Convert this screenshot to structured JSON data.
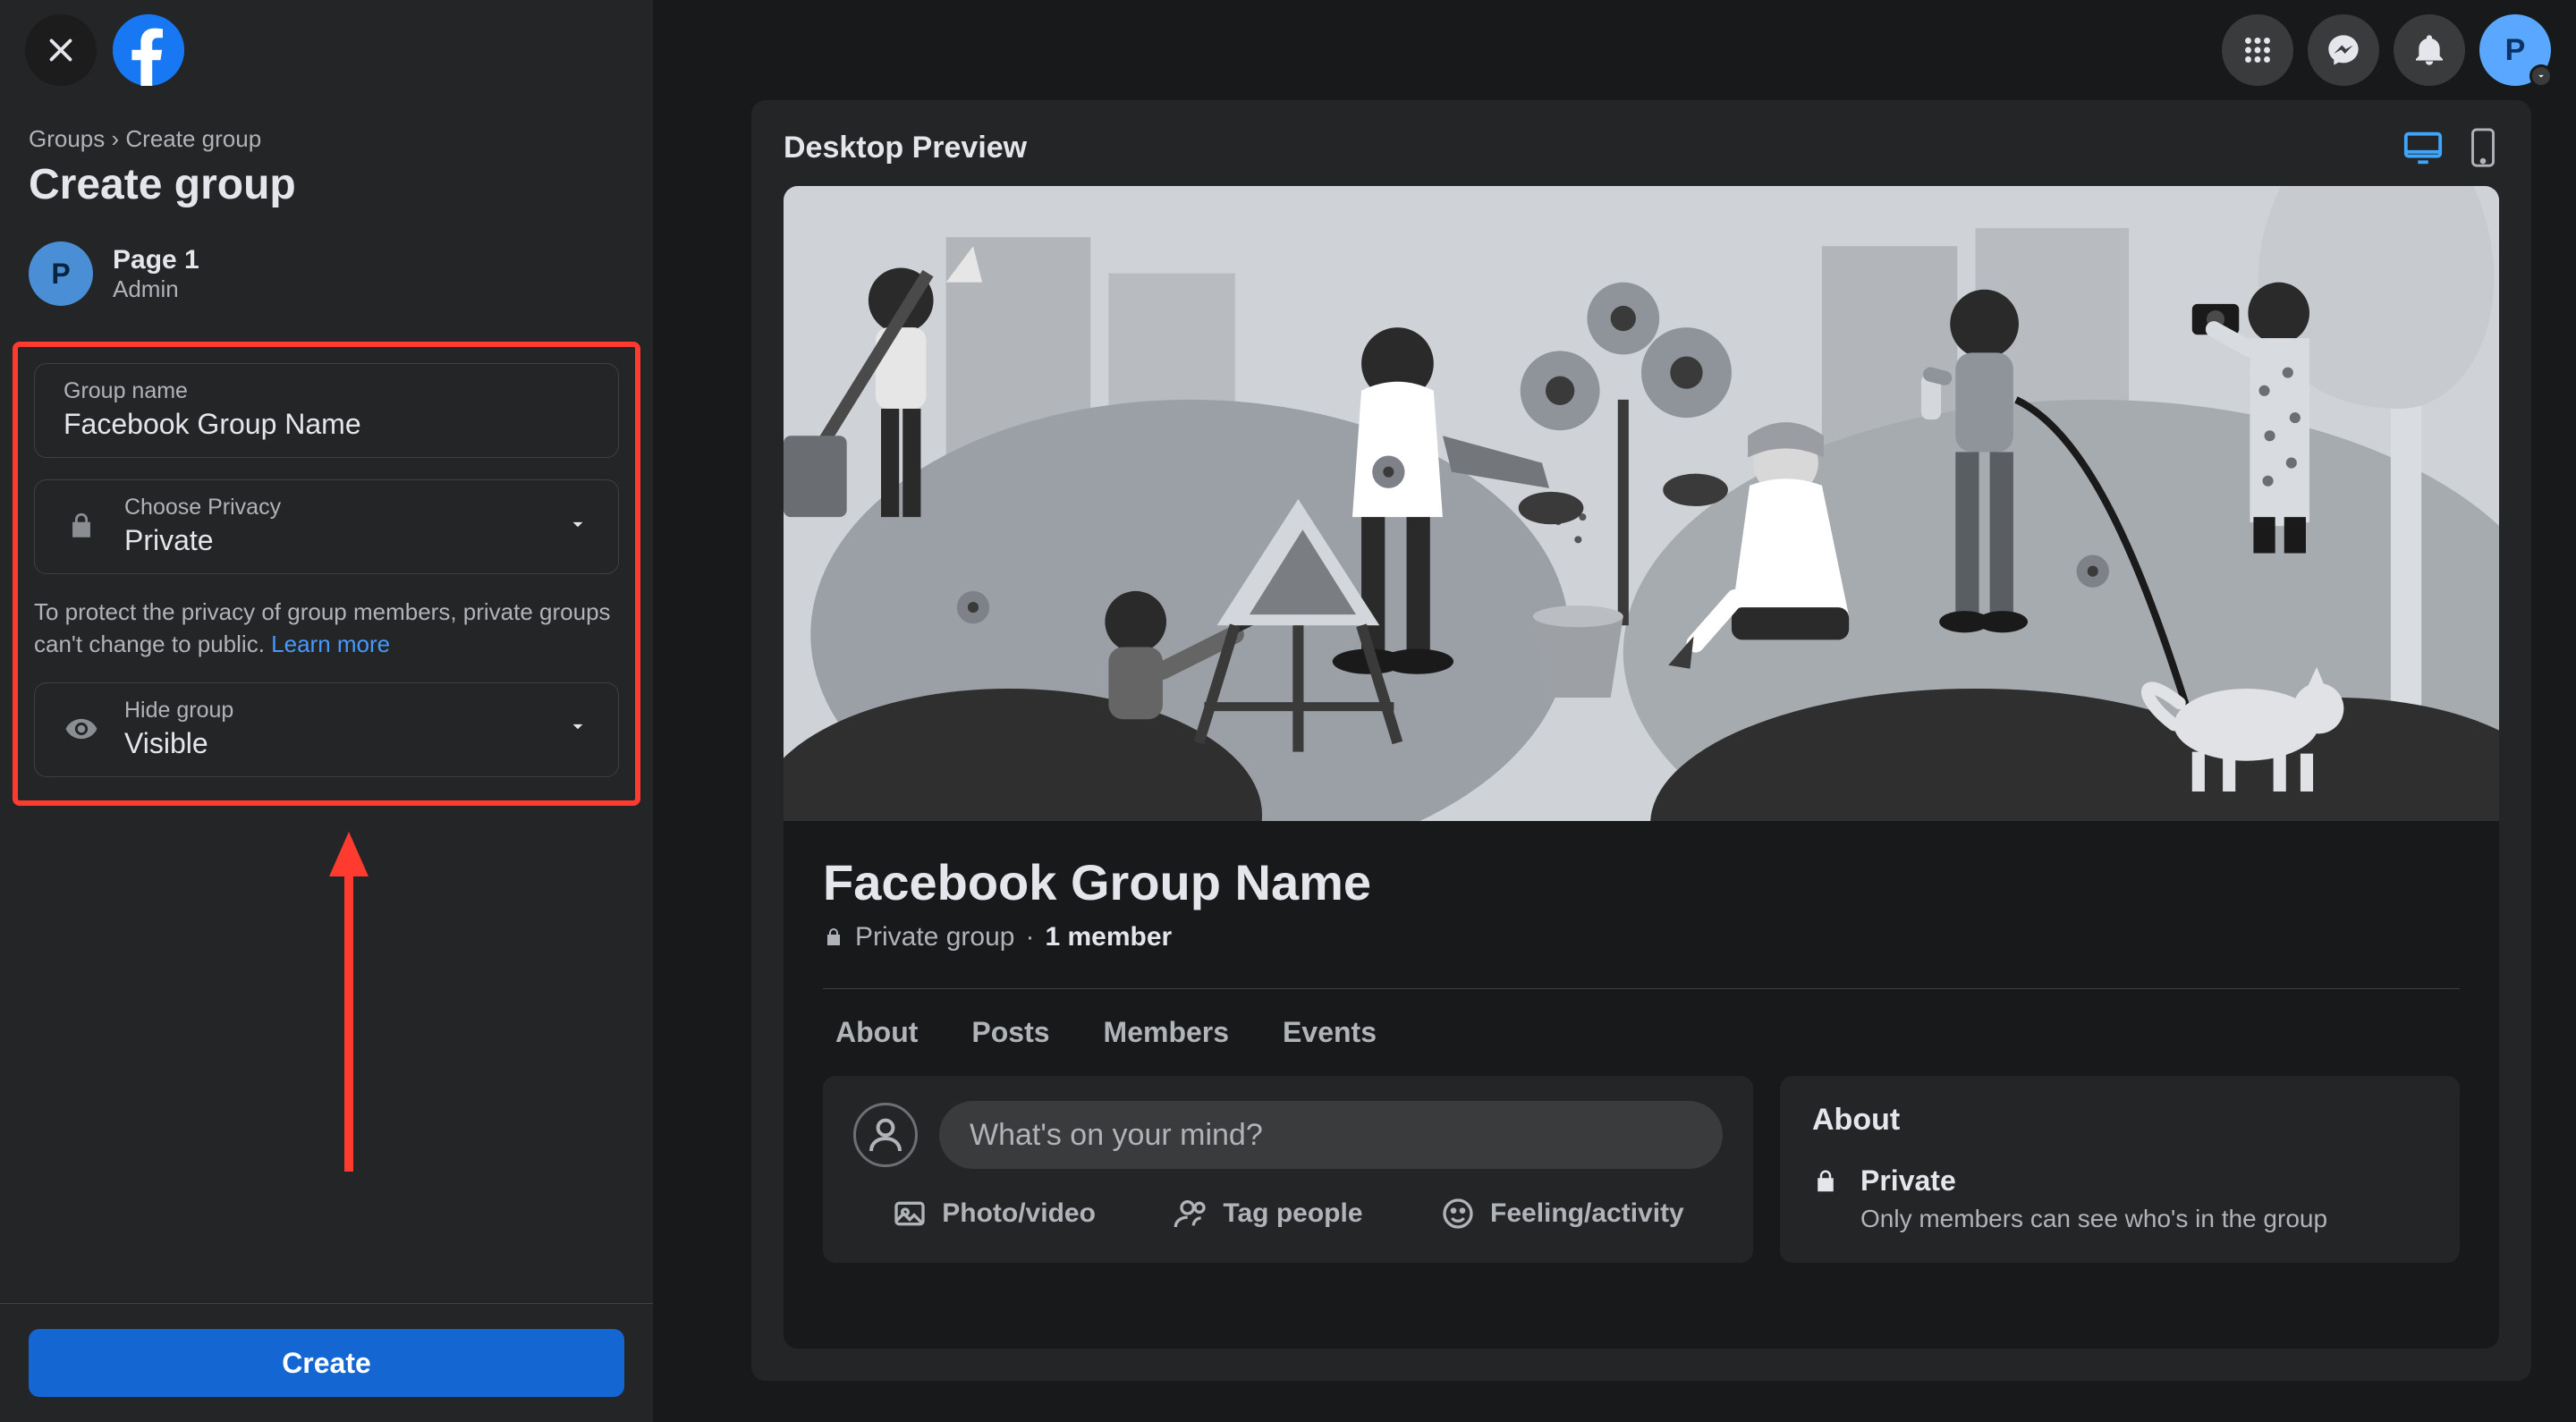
{
  "header": {
    "avatar_letter": "P"
  },
  "sidebar": {
    "breadcrumb": {
      "root": "Groups",
      "sep": "›",
      "current": "Create group"
    },
    "title": "Create group",
    "admin": {
      "avatar_letter": "P",
      "name": "Page 1",
      "role": "Admin"
    },
    "fields": {
      "group_name": {
        "label": "Group name",
        "value": "Facebook Group Name"
      },
      "privacy": {
        "label": "Choose Privacy",
        "value": "Private"
      },
      "visibility": {
        "label": "Hide group",
        "value": "Visible"
      }
    },
    "helper_text": "To protect the privacy of group members, private groups can't change to public. ",
    "helper_link": "Learn more",
    "create_label": "Create"
  },
  "preview": {
    "heading": "Desktop Preview",
    "group_name": "Facebook Group Name",
    "meta": {
      "privacy": "Private group",
      "sep": "·",
      "members": "1 member"
    },
    "tabs": [
      "About",
      "Posts",
      "Members",
      "Events"
    ],
    "composer": {
      "prompt": "What's on your mind?",
      "actions": [
        "Photo/video",
        "Tag people",
        "Feeling/activity"
      ]
    },
    "about": {
      "heading": "About",
      "privacy_title": "Private",
      "privacy_desc": "Only members can see who's in the group"
    }
  }
}
